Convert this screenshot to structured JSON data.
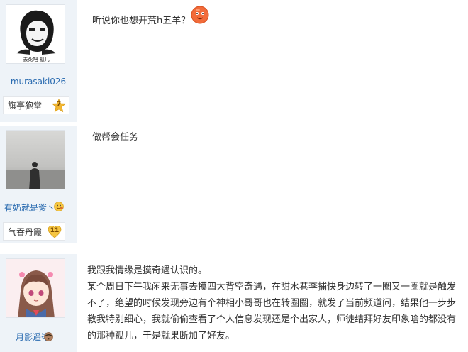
{
  "posts": [
    {
      "username": "murasaki026",
      "badge_label": "旗亭狍堂",
      "badge_level": "7",
      "avatar_caption": "去死吧 孤儿",
      "text": "听说你也想开荒h五羊？"
    },
    {
      "username": "有奶就是爹丶",
      "badge_label": "气吞丹霞",
      "badge_level": "11",
      "text": "做帮会任务"
    },
    {
      "username": "月影遥岑",
      "paragraph1": "我跟我情缘是摸奇遇认识的。",
      "lines": [
        "某个周日下午我闲来无事去摸四大背空奇遇，在甜水巷李捕快身边转了一圈又一圈就是触发",
        "不了，绝望的时候发现旁边有个神相小哥哥也在转圈圈，就发了当前频道问，结果他一步步",
        "教我特别细心，我就偷偷查看了个人信息发现还是个出家人，师徒结拜好友印象啥的都没有",
        "的那种孤儿，于是就果断加了好友。"
      ]
    }
  ],
  "colors": {
    "sidebar_bg": "#eef3f8",
    "username": "#2a6bb0",
    "badge_star": "#f2b632",
    "badge_heart": "#f5c542"
  },
  "icons": [
    "orange-face-emoji-icon",
    "grin-emoji-icon",
    "shy-emoji-icon",
    "star-level-icon",
    "heart-level-icon"
  ]
}
